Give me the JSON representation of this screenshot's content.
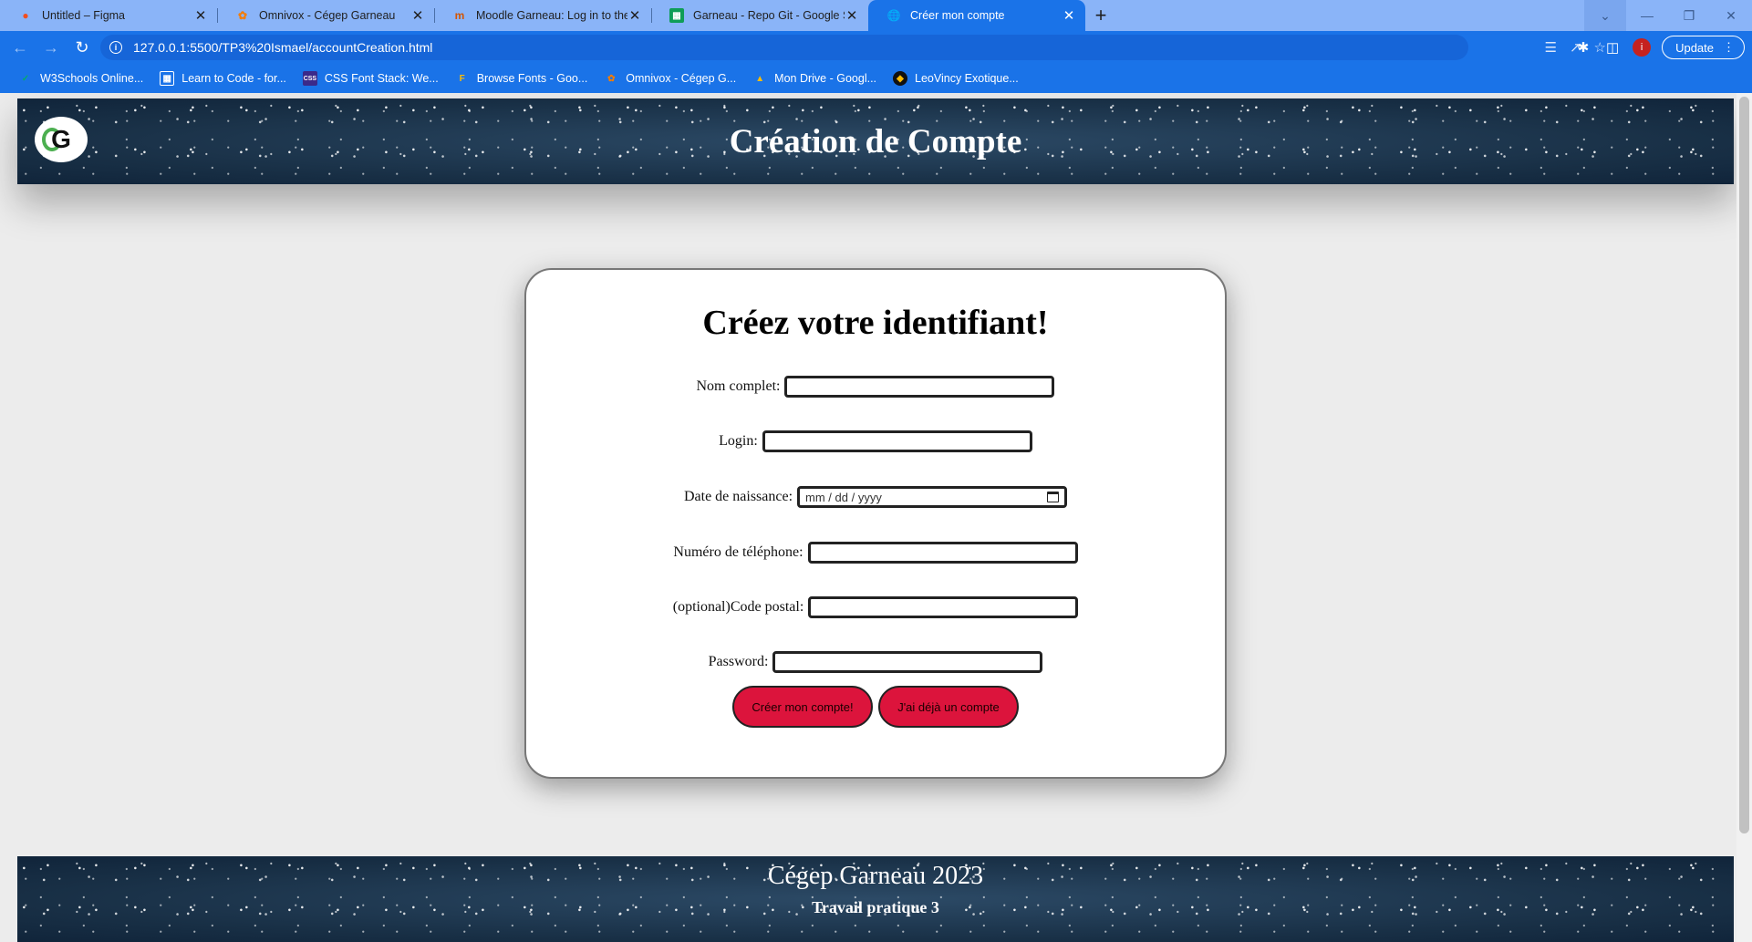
{
  "browser": {
    "tabs": [
      {
        "title": "Untitled – Figma",
        "icon": "figma-icon",
        "active": false
      },
      {
        "title": "Omnivox - Cégep Garneau",
        "icon": "omnivox-icon",
        "active": false
      },
      {
        "title": "Moodle Garneau: Log in to the si",
        "icon": "moodle-icon",
        "active": false
      },
      {
        "title": "Garneau - Repo Git - Google She",
        "icon": "sheets-icon",
        "active": false
      },
      {
        "title": "Créer mon compte",
        "icon": "globe-icon",
        "active": true
      }
    ],
    "url": "127.0.0.1:5500/TP3%20Ismael/accountCreation.html",
    "update_label": "Update",
    "profile_initial": "i",
    "bookmarks": [
      {
        "label": "W3Schools Online...",
        "icon": "w3schools-icon"
      },
      {
        "label": "Learn to Code - for...",
        "icon": "freecodecamp-icon"
      },
      {
        "label": "CSS Font Stack: We...",
        "icon": "cssfontstack-icon"
      },
      {
        "label": "Browse Fonts - Goo...",
        "icon": "google-fonts-icon"
      },
      {
        "label": "Omnivox - Cégep G...",
        "icon": "omnivox-icon"
      },
      {
        "label": "Mon Drive - Googl...",
        "icon": "google-drive-icon"
      },
      {
        "label": "LeoVincy Exotique...",
        "icon": "leovincy-icon"
      }
    ]
  },
  "page": {
    "header_title": "Création de Compte",
    "logo_letter": "G",
    "form": {
      "heading": "Créez votre identifiant!",
      "fields": {
        "full_name": {
          "label": "Nom complet:",
          "value": ""
        },
        "login": {
          "label": "Login:",
          "value": ""
        },
        "birthdate": {
          "label": "Date de naissance:",
          "placeholder": "mm / dd / yyyy"
        },
        "phone": {
          "label": "Numéro de téléphone:",
          "value": ""
        },
        "postal": {
          "label": "(optional)Code postal:",
          "value": ""
        },
        "password": {
          "label": "Password:",
          "value": ""
        }
      },
      "create_button": "Créer mon compte!",
      "existing_button": "J'ai déjà un compte"
    },
    "footer_title": "Cégep Garneau 2023",
    "footer_subtitle": "Travail pratique 3"
  }
}
